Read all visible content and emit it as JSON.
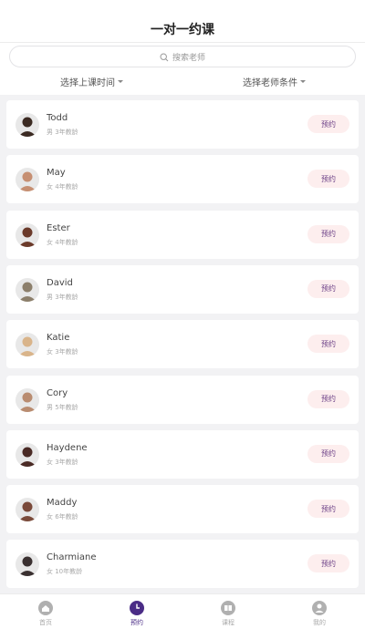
{
  "header": {
    "title": "一对一约课"
  },
  "search": {
    "placeholder": "搜索老师"
  },
  "filters": {
    "time": "选择上课时间",
    "teacher": "选择老师条件"
  },
  "teachers": [
    {
      "name": "Todd",
      "meta": "男 3年教龄",
      "action": "预约",
      "avatar_color": "#3b2a22"
    },
    {
      "name": "May",
      "meta": "女 4年教龄",
      "action": "预约",
      "avatar_color": "#c68f72"
    },
    {
      "name": "Ester",
      "meta": "女 4年教龄",
      "action": "预约",
      "avatar_color": "#6b3a2a"
    },
    {
      "name": "David",
      "meta": "男 3年教龄",
      "action": "预约",
      "avatar_color": "#8c7f6b"
    },
    {
      "name": "Katie",
      "meta": "女 3年教龄",
      "action": "预约",
      "avatar_color": "#d9b48a"
    },
    {
      "name": "Cory",
      "meta": "男 5年教龄",
      "action": "预约",
      "avatar_color": "#b98c70"
    },
    {
      "name": "Haydene",
      "meta": "女 3年教龄",
      "action": "预约",
      "avatar_color": "#4a2a25"
    },
    {
      "name": "Maddy",
      "meta": "女 6年教龄",
      "action": "预约",
      "avatar_color": "#7a4a3a"
    },
    {
      "name": "Charmiane",
      "meta": "女 10年教龄",
      "action": "预约",
      "avatar_color": "#3a3030"
    }
  ],
  "tabbar": {
    "items": [
      {
        "label": "首页",
        "icon": "home-icon"
      },
      {
        "label": "预约",
        "icon": "clock-icon"
      },
      {
        "label": "课程",
        "icon": "book-icon"
      },
      {
        "label": "我的",
        "icon": "user-icon"
      }
    ],
    "active_color": "#4a2c86",
    "inactive_color": "#b0b0b0"
  },
  "colors": {
    "button_bg": "#fdeeee",
    "button_text": "#6b3f86"
  }
}
